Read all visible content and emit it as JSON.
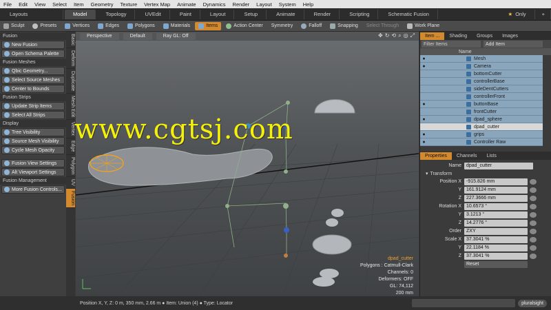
{
  "menubar": [
    "File",
    "Edit",
    "View",
    "Select",
    "Item",
    "Geometry",
    "Texture",
    "Vertex Map",
    "Animate",
    "Dynamics",
    "Render",
    "Layout",
    "System",
    "Help"
  ],
  "layout_tabs": {
    "layouts_label": "Layouts",
    "tabs": [
      "Model",
      "Topology",
      "UVEdit",
      "Paint",
      "Layout",
      "Setup",
      "Animate",
      "Render",
      "Scripting",
      "Schematic Fusion"
    ],
    "active": "Model",
    "star_label": "Only"
  },
  "toolbar2": {
    "sculpt": "Sculpt",
    "presets": "Presets",
    "modes": [
      "Vertices",
      "Edges",
      "Polygons",
      "Materials",
      "Items"
    ],
    "active_mode": "Items",
    "action_center": "Action Center",
    "symmetry": "Symmetry",
    "falloff": "Falloff",
    "snapping": "Snapping",
    "select_through": "Select Through",
    "work_plane": "Work Plane"
  },
  "left_panel": {
    "sections": [
      {
        "title": "Fusion",
        "buttons": [
          "New Fusion",
          "Open Schema Palette"
        ]
      },
      {
        "title": "Fusion Meshes",
        "buttons": [
          "Qbic Geometry...",
          "Select Source Meshes",
          "Center to Bounds"
        ]
      },
      {
        "title": "Fusion Strips",
        "buttons": [
          "Update Strip Items",
          "Select All Strips"
        ]
      },
      {
        "title": "Display",
        "buttons": [
          "Tree Visibility",
          "Source Mesh Visibility",
          "Cycle Mesh Opacity"
        ]
      },
      {
        "title": "",
        "buttons": [
          "Fusion View Settings",
          "Alt Viewport Settings"
        ]
      },
      {
        "title": "Fusion Management",
        "buttons": [
          "More Fusion Controls..."
        ]
      }
    ],
    "vertical_tabs": [
      "Basic",
      "Deform",
      "Duplicate",
      "Mesh Edit",
      "Vertex",
      "Edge",
      "Polygon",
      "UV",
      "Fusion"
    ],
    "active_vtab": "Fusion"
  },
  "viewport": {
    "header": [
      "Perspective",
      "Default",
      "Ray GL: Off"
    ],
    "watermark": "www.cgtsj.com",
    "info": {
      "selected": "dpad_cutter",
      "polygons": "Polygons : Catmull-Clark",
      "channels": "Channels: 0",
      "deformers": "Deformers: OFF",
      "gl": "GL: 74,112",
      "size": "200 mm"
    }
  },
  "items_panel": {
    "tabs": [
      "Item ...",
      "Shading",
      "Groups",
      "Images"
    ],
    "active_tab": "Item ...",
    "filter_placeholder": "Filter Items",
    "add_item": "Add Item",
    "column_name": "Name",
    "items": [
      {
        "name": "Mesh",
        "eye": true,
        "selected": false
      },
      {
        "name": "Camera",
        "eye": true,
        "selected": false
      },
      {
        "name": "bottomCutter",
        "eye": false,
        "selected": false
      },
      {
        "name": "controllerBase",
        "eye": false,
        "selected": false
      },
      {
        "name": "sideDentCutters",
        "eye": false,
        "selected": false
      },
      {
        "name": "controllerFront",
        "eye": false,
        "selected": false
      },
      {
        "name": "buttonBase",
        "eye": true,
        "selected": false
      },
      {
        "name": "frontCutter",
        "eye": false,
        "selected": false
      },
      {
        "name": "dpad_sphere",
        "eye": true,
        "selected": false
      },
      {
        "name": "dpad_cutter",
        "eye": false,
        "selected": true
      },
      {
        "name": "grips",
        "eye": true,
        "selected": false
      },
      {
        "name": "Controller Raw",
        "eye": true,
        "selected": false
      }
    ]
  },
  "properties_panel": {
    "tabs": [
      "Properties",
      "Channels",
      "Lists"
    ],
    "active_tab": "Properties",
    "name_label": "Name",
    "name_value": "dpad_cutter",
    "section": "Transform",
    "rows": [
      {
        "label": "Position X",
        "value": "-915.826 mm"
      },
      {
        "label": "Y",
        "value": "161.9124 mm"
      },
      {
        "label": "Z",
        "value": "227.3666 mm"
      },
      {
        "label": "Rotation X",
        "value": "10.6573 °"
      },
      {
        "label": "Y",
        "value": "3.1213 °"
      },
      {
        "label": "Z",
        "value": "14.2776 °"
      },
      {
        "label": "Order",
        "value": "ZXY"
      },
      {
        "label": "Scale X",
        "value": "37.3041 %"
      },
      {
        "label": "Y",
        "value": "22.1184 %"
      },
      {
        "label": "Z",
        "value": "37.3041 %"
      }
    ],
    "reset": "Reset"
  },
  "statusbar": {
    "text": "Position X, Y, Z:   0 m, 350 mm, 2.66 m  ●  Item:  Union (4)  ●  Type:  Locator",
    "brand": "pluralsight"
  }
}
